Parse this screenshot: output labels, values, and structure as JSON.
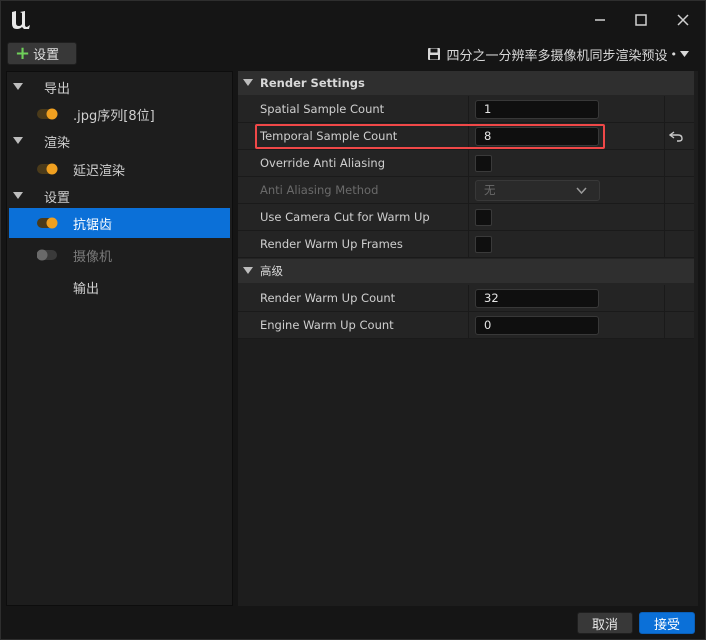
{
  "window": {
    "logo": "unreal-engine-logo",
    "controls": [
      "minimize-icon",
      "maximize-icon",
      "close-icon"
    ]
  },
  "toolbar": {
    "add_label": "设置",
    "preset_name": "四分之一分辨率多摄像机同步渲染预设",
    "dirty_marker": "•"
  },
  "tree": {
    "groups": [
      {
        "label": "导出",
        "expanded": true
      },
      {
        "label": "渲染",
        "expanded": true
      },
      {
        "label": "设置",
        "expanded": true
      }
    ],
    "items": [
      {
        "label": ".jpg序列[8位]",
        "enabled": true
      },
      {
        "label": "延迟渲染",
        "enabled": true
      },
      {
        "label": "抗锯齿",
        "enabled": true,
        "selected": true
      },
      {
        "label": "摄像机",
        "enabled": false
      },
      {
        "label": "输出"
      }
    ]
  },
  "properties": {
    "section_main": "Render Settings",
    "section_advanced": "高级",
    "rows": [
      {
        "name": "Spatial Sample Count",
        "type": "number",
        "value": "1"
      },
      {
        "name": "Temporal Sample Count",
        "type": "number",
        "value": "8",
        "highlighted": true,
        "modified": true
      },
      {
        "name": "Override Anti Aliasing",
        "type": "checkbox",
        "checked": false
      },
      {
        "name": "Anti Aliasing Method",
        "type": "combo",
        "value": "无",
        "disabled": true
      },
      {
        "name": "Use Camera Cut for Warm Up",
        "type": "checkbox",
        "checked": false
      },
      {
        "name": "Render Warm Up Frames",
        "type": "checkbox",
        "checked": false
      }
    ],
    "advanced_rows": [
      {
        "name": "Render Warm Up Count",
        "type": "number",
        "value": "32"
      },
      {
        "name": "Engine Warm Up Count",
        "type": "number",
        "value": "0"
      }
    ]
  },
  "footer": {
    "cancel_label": "取消",
    "accept_label": "接受"
  },
  "colors": {
    "accent": "#0b70d8",
    "toggle_on": "#f0a020",
    "highlight": "#f04848",
    "add_plus": "#6fd05a"
  }
}
